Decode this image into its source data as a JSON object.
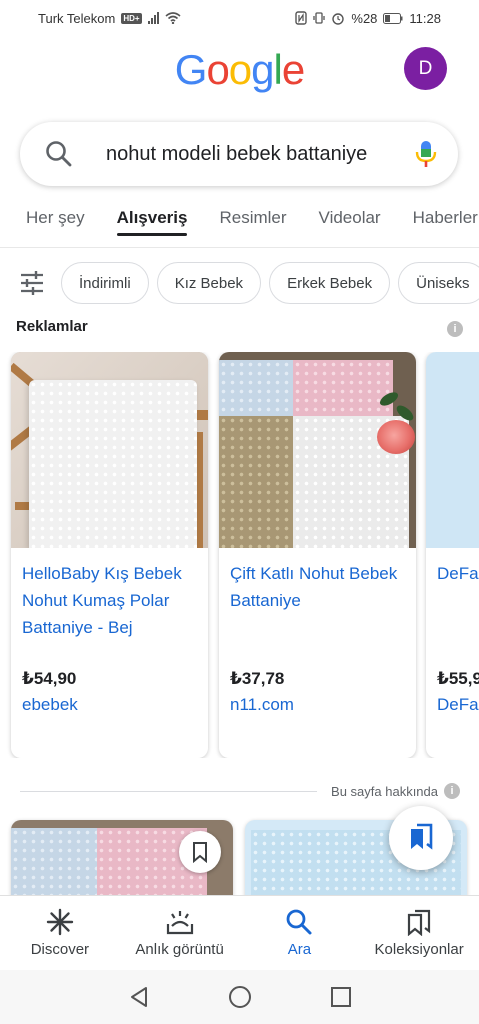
{
  "status_bar": {
    "carrier": "Turk Telekom",
    "hd_badge": "HD+",
    "battery": "%28",
    "time": "11:28"
  },
  "header": {
    "logo_letters": [
      "G",
      "o",
      "o",
      "g",
      "l",
      "e"
    ],
    "logo_colors": [
      "#4285F4",
      "#EA4335",
      "#FBBC05",
      "#4285F4",
      "#34A853",
      "#EA4335"
    ],
    "avatar_letter": "D",
    "avatar_color": "#7b1fa2"
  },
  "search": {
    "query": "nohut modeli bebek battaniye"
  },
  "tabs": [
    {
      "label": "Her şey",
      "active": false
    },
    {
      "label": "Alışveriş",
      "active": true
    },
    {
      "label": "Resimler",
      "active": false
    },
    {
      "label": "Videolar",
      "active": false
    },
    {
      "label": "Haberler",
      "active": false
    }
  ],
  "chips": [
    "İndirimli",
    "Kız Bebek",
    "Erkek Bebek",
    "Üniseks"
  ],
  "ads": {
    "label": "Reklamlar",
    "info_glyph": "i"
  },
  "products": [
    {
      "title": "HelloBaby Kış Bebek Nohut Kumaş Polar Battaniye - Bej",
      "price": "₺54,90",
      "store": "ebebek"
    },
    {
      "title": "Çift Katlı Nohut Bebek Battaniye",
      "price": "₺37,78",
      "store": "n11.com"
    },
    {
      "title": "DeFa Nohu Batta",
      "price": "₺55,9",
      "store": "DeFa"
    }
  ],
  "about": {
    "text": "Bu sayfa hakkında",
    "info_glyph": "i"
  },
  "bottom_nav": [
    {
      "label": "Discover",
      "icon": "asterisk-icon",
      "active": false
    },
    {
      "label": "Anlık görüntü",
      "icon": "snapshot-icon",
      "active": false
    },
    {
      "label": "Ara",
      "icon": "search-icon",
      "active": true
    },
    {
      "label": "Koleksiyonlar",
      "icon": "collections-icon",
      "active": false
    }
  ],
  "colors": {
    "link_blue": "#1967d2",
    "active_blue": "#1967d2",
    "avatar_purple": "#7b1fa2"
  }
}
